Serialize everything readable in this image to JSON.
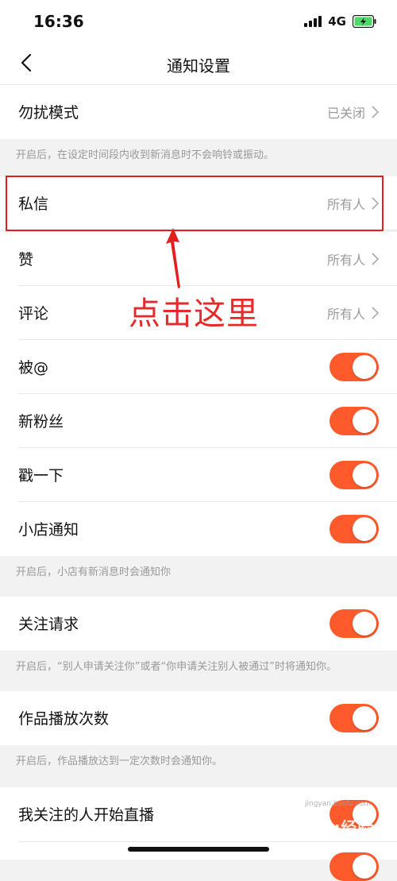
{
  "status_bar": {
    "time": "16:36",
    "network": "4G"
  },
  "nav": {
    "title": "通知设置",
    "back_icon": "chevron-left-icon"
  },
  "dnd": {
    "label": "勿扰模式",
    "value": "已关闭",
    "hint": "开启后，在设定时间段内收到新消息时不会响铃或振动。"
  },
  "messages": {
    "label": "私信",
    "value": "所有人"
  },
  "likes": {
    "label": "赞",
    "value": "所有人"
  },
  "comments": {
    "label": "评论",
    "value": "所有人"
  },
  "mentions": {
    "label": "被@",
    "on": true
  },
  "followers": {
    "label": "新粉丝",
    "on": true
  },
  "poke": {
    "label": "戳一下",
    "on": true
  },
  "shop": {
    "label": "小店通知",
    "on": true,
    "hint": "开启后，小店有新消息时会通知你"
  },
  "follow_request": {
    "label": "关注请求",
    "on": true,
    "hint": "开启后，“别人申请关注你”或者“你申请关注别人被通过”时将通知你。"
  },
  "play_count": {
    "label": "作品播放次数",
    "on": true,
    "hint": "开启后，作品播放达到一定次数时会通知你。"
  },
  "live": {
    "label": "我关注的人开始直播",
    "on": true
  },
  "annotation": {
    "text": "点击这里"
  },
  "watermark": {
    "text": "Baidu经验",
    "sub": "jingyan.baidu.com"
  },
  "colors": {
    "accent": "#fe5a2b",
    "annotation": "#e21e1e"
  }
}
